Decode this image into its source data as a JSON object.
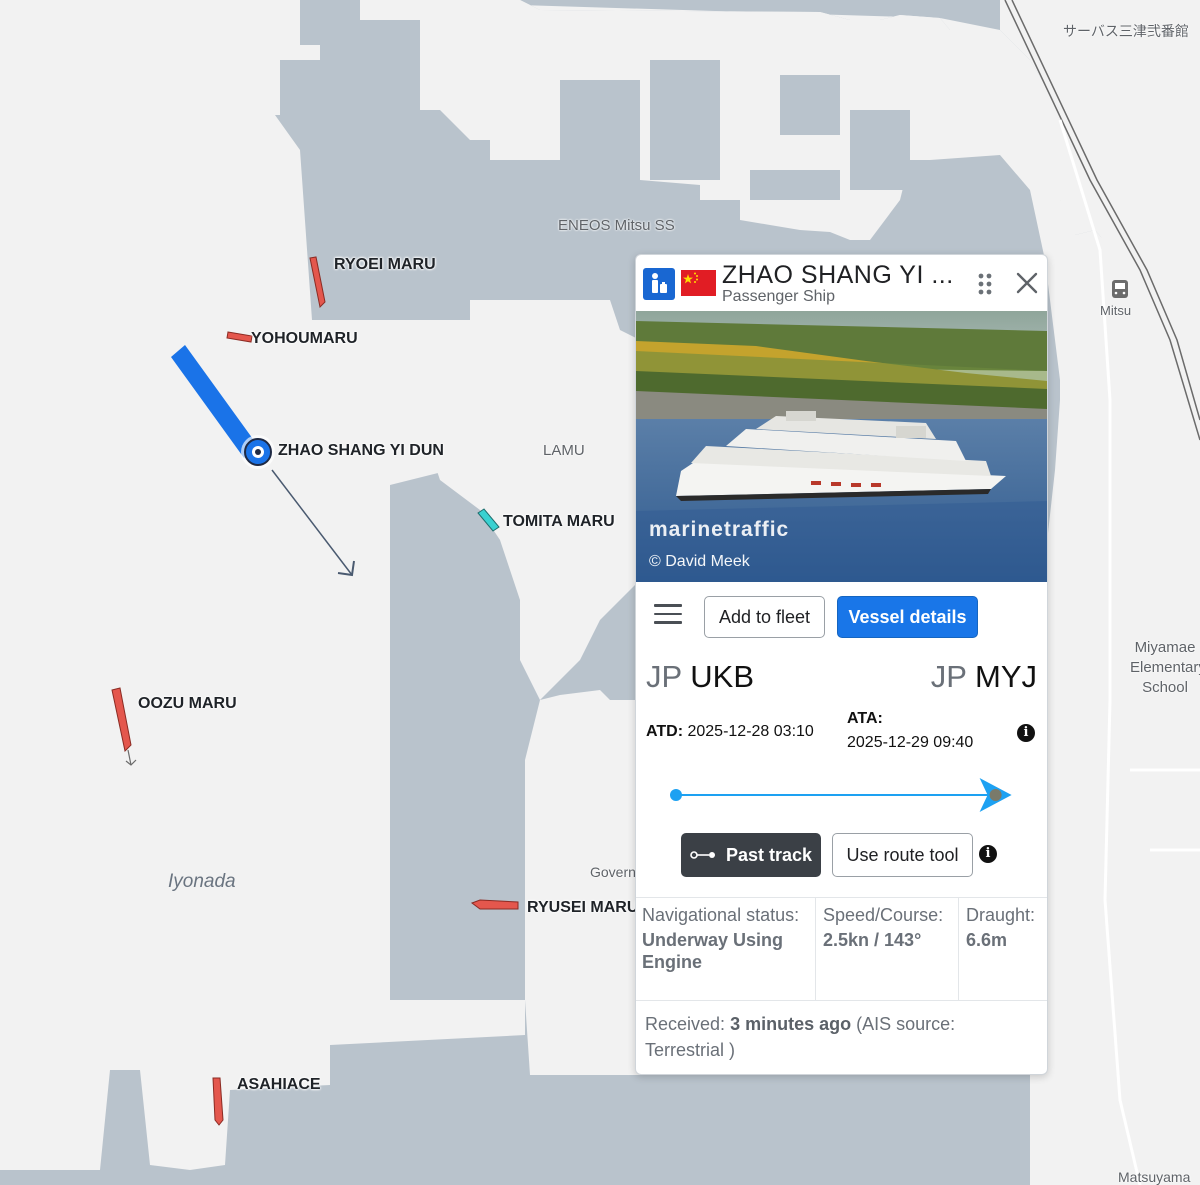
{
  "map": {
    "sea_name": "Iyonada",
    "places": {
      "eneos": "ENEOS Mitsu SS",
      "lamu": "LAMU",
      "station": "Mitsu",
      "service": "サーバス三津弐番館",
      "school": "Miyamae\nElementary\nSchool",
      "govern": "Govern",
      "matsuyama": "Matsuyama"
    },
    "ship_labels": {
      "ryoei": "RYOEI MARU",
      "yohoumaru": "YOHOUMARU",
      "zhao": "ZHAO SHANG YI DUN",
      "tomita": "TOMITA MARU",
      "oozu": "OOZU MARU",
      "ryusei": "RYUSEI MARU",
      "asahiace": "ASAHIACE"
    },
    "colors": {
      "water": "#b9c3cc",
      "land": "#f2f2f2",
      "cargo_ship": "#e4574d",
      "tug_ship": "#3ad1d1",
      "passenger_ship": "#1a73e8"
    }
  },
  "popup": {
    "name": "ZHAO SHANG YI ...",
    "type": "Passenger Ship",
    "type_icon": "passenger-icon",
    "flag": "china-flag",
    "photo": {
      "watermark": "marinetraffic",
      "credit": "© David Meek"
    },
    "buttons": {
      "add_fleet": "Add to fleet",
      "details": "Vessel details",
      "past_track": "Past track",
      "route_tool": "Use route tool"
    },
    "departure": {
      "country": "JP",
      "code": "UKB"
    },
    "arrival": {
      "country": "JP",
      "code": "MYJ"
    },
    "atd_label": "ATD:",
    "atd_value": "2025-12-28 03:10",
    "ata_label": "ATA:",
    "ata_value": "2025-12-29 09:40",
    "voyage_progress": 0.94,
    "stats": {
      "nav_label": "Navigational status:",
      "nav_value": "Underway Using Engine",
      "speed_label": "Speed/Course:",
      "speed_value": "2.5kn / 143°",
      "draught_label": "Draught:",
      "draught_value": "6.6m"
    },
    "received_prefix": "Received:",
    "received_value": "3 minutes ago",
    "received_suffix": "(AIS source: Terrestrial )"
  }
}
